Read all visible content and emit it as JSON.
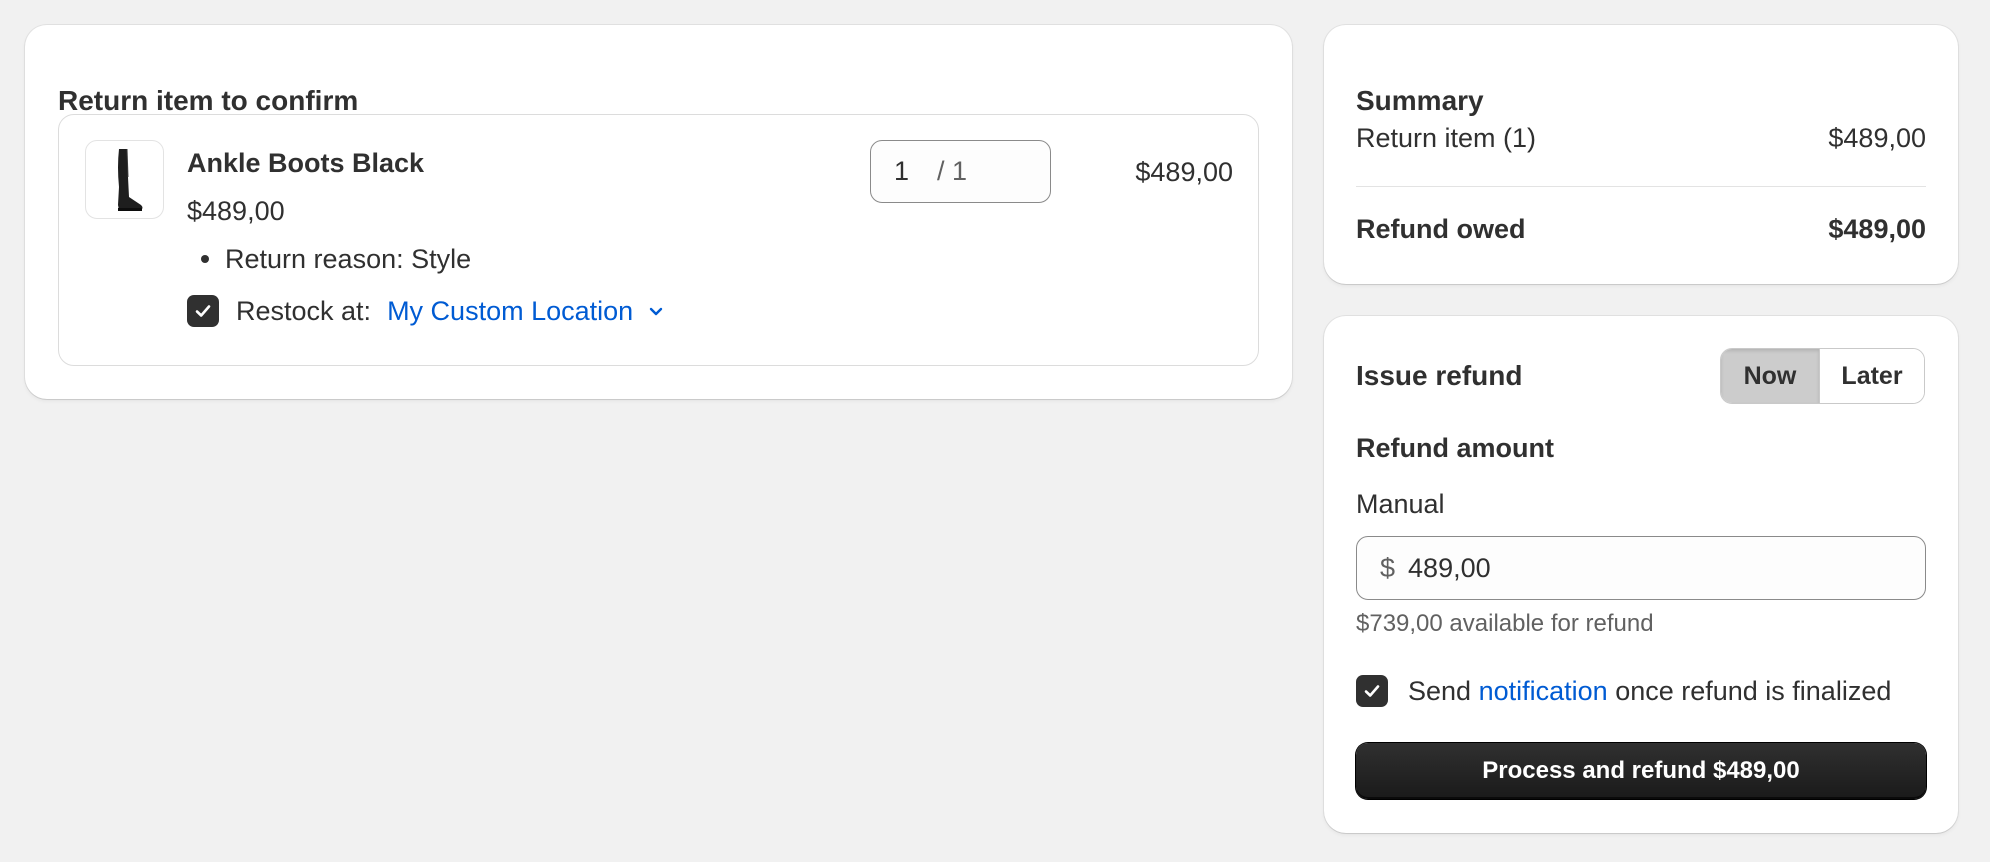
{
  "return_card": {
    "title": "Return item to confirm",
    "item": {
      "name": "Ankle Boots Black",
      "price": "$489,00",
      "return_reason": "Return reason: Style",
      "restock_label": "Restock at:",
      "restock_location": "My Custom Location",
      "restock_checked": true,
      "quantity_value": "1",
      "quantity_total": "/ 1",
      "line_total": "$489,00"
    }
  },
  "summary": {
    "title": "Summary",
    "return_item_label": "Return item (1)",
    "return_item_value": "$489,00",
    "refund_owed_label": "Refund owed",
    "refund_owed_value": "$489,00"
  },
  "refund": {
    "title": "Issue refund",
    "toggle_now": "Now",
    "toggle_later": "Later",
    "toggle_selected": "Now",
    "amount_label": "Refund amount",
    "manual_label": "Manual",
    "currency_prefix": "$",
    "amount_value": "489,00",
    "available_text": "$739,00 available for refund",
    "notify_checked": true,
    "notify_prefix": "Send",
    "notify_link": "notification",
    "notify_suffix": "once refund is finalized",
    "process_button": "Process and refund $489,00"
  },
  "colors": {
    "background": "#f1f1f1",
    "card": "#ffffff",
    "link": "#005bd3",
    "primary_button": "#1a1a1a",
    "checkbox": "#303030"
  },
  "icons": {
    "product_thumbnail": "boot-image",
    "checkbox_check": "check-icon",
    "dropdown": "chevron-down-icon"
  }
}
